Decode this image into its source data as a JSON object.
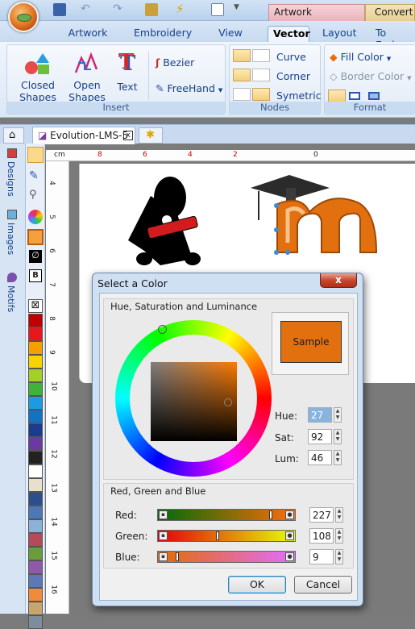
{
  "titlebar": {
    "context_artwork": "Artwork",
    "context_convert": "Convert"
  },
  "ribbon_tabs": [
    "Artwork",
    "Embroidery",
    "View",
    "Vector",
    "Layout",
    "To Embro"
  ],
  "ribbon": {
    "insert": {
      "closed_line1": "Closed",
      "closed_line2": "Shapes",
      "open_line1": "Open",
      "open_line2": "Shapes",
      "text": "Text",
      "bezier": "Bezier",
      "freehand": "FreeHand",
      "label": "Insert"
    },
    "nodes": {
      "curve": "Curve",
      "corner": "Corner",
      "symmetric": "Symetric",
      "label": "Nodes"
    },
    "format": {
      "fill_color": "Fill Color",
      "border_color": "Border Color",
      "label": "Format"
    }
  },
  "doc_tab": {
    "name": "Evolution-LMS-5"
  },
  "side_tabs": [
    "Designs",
    "Images",
    "Motifs"
  ],
  "ruler": {
    "unit": "cm",
    "h_ticks": [
      "8",
      "6",
      "4",
      "2",
      "0"
    ],
    "v_ticks": [
      "4",
      "5",
      "6",
      "7",
      "8",
      "9",
      "10",
      "11",
      "12",
      "13",
      "14",
      "15",
      "16"
    ]
  },
  "toolbox": {
    "b_label": "B"
  },
  "palette": [
    "#c00000",
    "#e8171c",
    "#f4a000",
    "#f8d300",
    "#a3cf26",
    "#3fb23c",
    "#1b9ce0",
    "#1073c5",
    "#1b3c8e",
    "#6a3aa0",
    "#222222",
    "#ffffff",
    "#e8e0cc",
    "#2c4f8c",
    "#4b79b7",
    "#8cb0d8",
    "#b34b5b",
    "#6a9c3c",
    "#8f5aa8",
    "#5d77b7",
    "#f08a3c",
    "#c9a46c",
    "#7d8d9d"
  ],
  "dialog": {
    "title": "Select a Color",
    "hsl_group": "Hue, Saturation and Luminance",
    "sample_label": "Sample",
    "sample_color": "#e3700f",
    "hue_label": "Hue:",
    "hue": "27",
    "sat_label": "Sat:",
    "sat": "92",
    "lum_label": "Lum:",
    "lum": "46",
    "rgb_group": "Red, Green and Blue",
    "red_label": "Red:",
    "red": "227",
    "green_label": "Green:",
    "green": "108",
    "blue_label": "Blue:",
    "blue": "9",
    "ok": "OK",
    "cancel": "Cancel",
    "close": "x"
  }
}
